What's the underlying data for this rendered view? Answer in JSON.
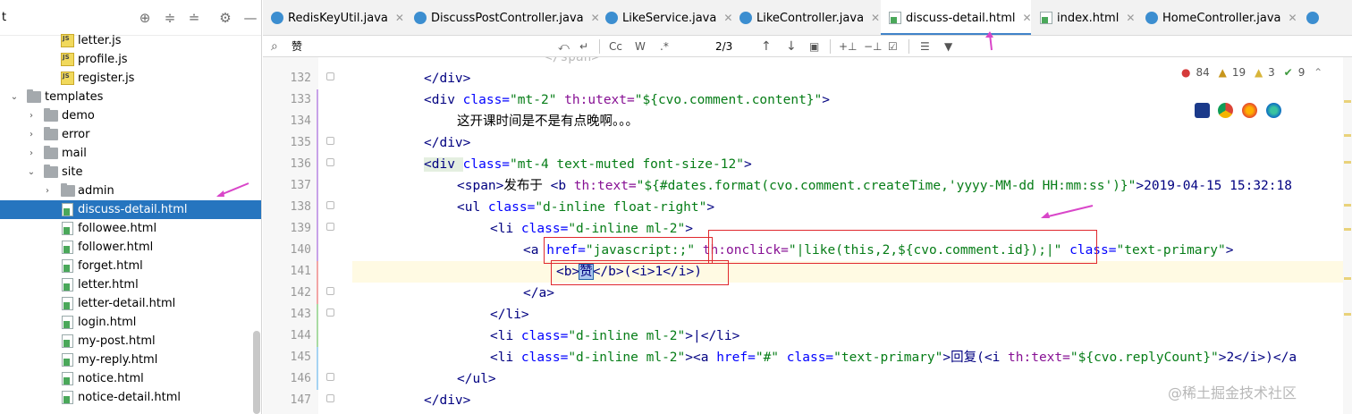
{
  "project": {
    "title_fragment": "t",
    "items": [
      {
        "label": "letter.js",
        "type": "js",
        "depth": 3
      },
      {
        "label": "profile.js",
        "type": "js",
        "depth": 3
      },
      {
        "label": "register.js",
        "type": "js",
        "depth": 3
      },
      {
        "label": "templates",
        "type": "folder",
        "depth": 1,
        "expanded": true
      },
      {
        "label": "demo",
        "type": "folder",
        "depth": 2
      },
      {
        "label": "error",
        "type": "folder",
        "depth": 2
      },
      {
        "label": "mail",
        "type": "folder",
        "depth": 2
      },
      {
        "label": "site",
        "type": "folder",
        "depth": 2,
        "expanded": true
      },
      {
        "label": "admin",
        "type": "folder",
        "depth": 3
      },
      {
        "label": "discuss-detail.html",
        "type": "html",
        "depth": 3,
        "selected": true
      },
      {
        "label": "followee.html",
        "type": "html",
        "depth": 3
      },
      {
        "label": "follower.html",
        "type": "html",
        "depth": 3
      },
      {
        "label": "forget.html",
        "type": "html",
        "depth": 3
      },
      {
        "label": "letter.html",
        "type": "html",
        "depth": 3
      },
      {
        "label": "letter-detail.html",
        "type": "html",
        "depth": 3
      },
      {
        "label": "login.html",
        "type": "html",
        "depth": 3
      },
      {
        "label": "my-post.html",
        "type": "html",
        "depth": 3
      },
      {
        "label": "my-reply.html",
        "type": "html",
        "depth": 3
      },
      {
        "label": "notice.html",
        "type": "html",
        "depth": 3
      },
      {
        "label": "notice-detail.html",
        "type": "html",
        "depth": 3
      }
    ]
  },
  "tabs": [
    {
      "label": "RedisKeyUtil.java",
      "kind": "java"
    },
    {
      "label": "DiscussPostController.java",
      "kind": "java"
    },
    {
      "label": "LikeService.java",
      "kind": "java"
    },
    {
      "label": "LikeController.java",
      "kind": "java"
    },
    {
      "label": "discuss-detail.html",
      "kind": "html",
      "active": true
    },
    {
      "label": "index.html",
      "kind": "html"
    },
    {
      "label": "HomeController.java",
      "kind": "java"
    }
  ],
  "search": {
    "query": "赞",
    "match_case": "Cc",
    "words": "W",
    "regex": ".*",
    "result": "2/3"
  },
  "status": {
    "errors": "84",
    "warnings": "19",
    "weak": "3",
    "ok": "9"
  },
  "code": {
    "line_numbers": [
      "132",
      "133",
      "134",
      "135",
      "136",
      "137",
      "138",
      "139",
      "140",
      "141",
      "142",
      "143",
      "144",
      "145",
      "146",
      "147"
    ],
    "l132": "</div>",
    "l133_open": "<div ",
    "l133_attr": "class=",
    "l133_val": "\"mt-2\"",
    "l133_attr2": " th:utext=",
    "l133_val2": "\"${cvo.comment.content}\"",
    "l133_close": ">",
    "l134": "这开课时间是不是有点晚啊。。。",
    "l135": "</div>",
    "l136_open": "<div ",
    "l136_attr": "class=",
    "l136_val": "\"mt-4 text-muted font-size-12\"",
    "l136_close": ">",
    "l137_open": "<span>",
    "l137_text": "发布于 ",
    "l137_b": "<b ",
    "l137_attr": "th:text=",
    "l137_val": "\"${#dates.format(cvo.comment.createTime,'yyyy-MM-dd HH:mm:ss')}\"",
    "l137_rest": ">2019-04-15 15:32:18",
    "l138_open": "<ul ",
    "l138_attr": "class=",
    "l138_val": "\"d-inline float-right\"",
    "l138_close": ">",
    "l139_open": "<li ",
    "l139_attr": "class=",
    "l139_val": "\"d-inline ml-2\"",
    "l139_close": ">",
    "l140_open": "<a ",
    "l140_attr": "href=",
    "l140_val": "\"javascript:;\"",
    "l140_attr2": " th:onclick=",
    "l140_val2": "\"|like(this,2,${cvo.comment.id});|\"",
    "l140_attr3": " class=",
    "l140_val3": "\"text-primary\"",
    "l140_close": ">",
    "l141_b": "<b>",
    "l141_hl": "赞",
    "l141_rest": "</b>(<i>1</i>)",
    "l142": "</a>",
    "l143": "</li>",
    "l144_open": "<li ",
    "l144_attr": "class=",
    "l144_val": "\"d-inline ml-2\"",
    "l144_rest": ">|</li>",
    "l145_open": "<li ",
    "l145_attr": "class=",
    "l145_val": "\"d-inline ml-2\"",
    "l145_mid": "><a ",
    "l145_attr2": "href=",
    "l145_val2": "\"#\"",
    "l145_attr3": " class=",
    "l145_val3": "\"text-primary\"",
    "l145_text": ">回复(<i ",
    "l145_attr4": "th:text=",
    "l145_val4": "\"${cvo.replyCount}\"",
    "l145_end": ">2</i>)</a",
    "l146": "</ul>",
    "l147": "</div>"
  },
  "watermark": "@稀土掘金技术社区",
  "colors": {
    "accent": "#2675bf",
    "annotation": "#e0282d",
    "arrow": "#d946c9"
  }
}
